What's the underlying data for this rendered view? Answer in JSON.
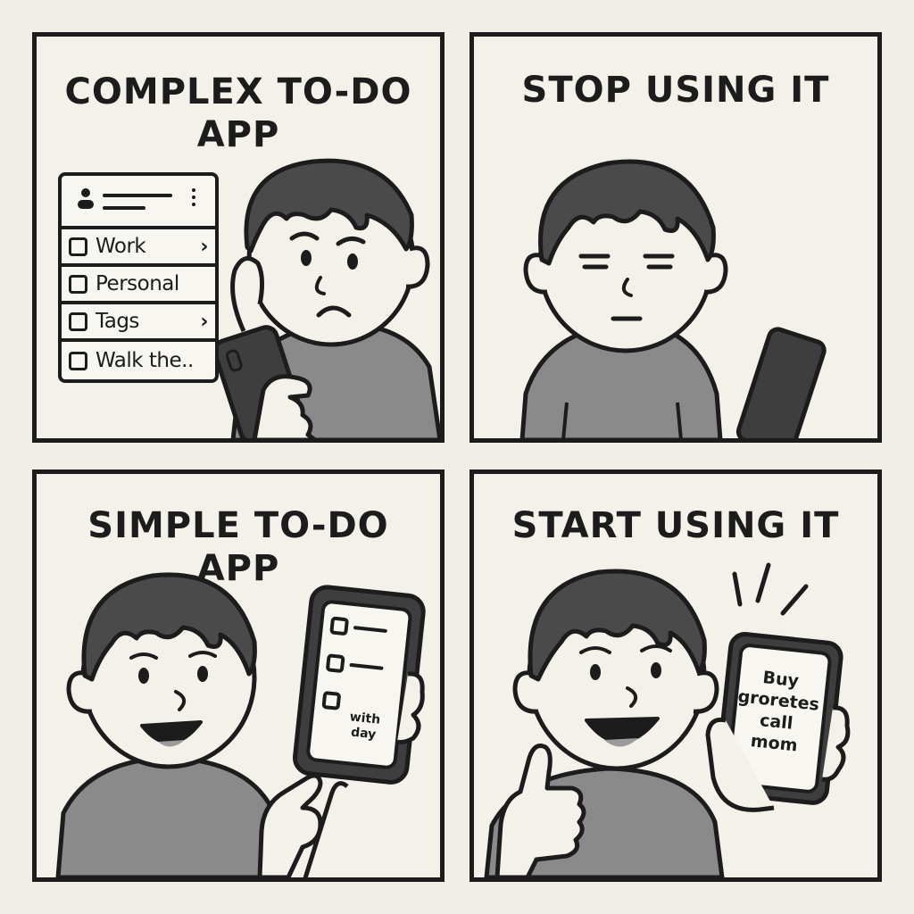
{
  "panels": {
    "complex": {
      "caption_line1": "COMPLEX TO-DO",
      "caption_line2": "APP",
      "menu_items": [
        {
          "label": "Work",
          "chevron": "›"
        },
        {
          "label": "Personal",
          "chevron": ""
        },
        {
          "label": "Tags",
          "chevron": "›"
        },
        {
          "label": "Walk the..",
          "chevron": ""
        }
      ]
    },
    "stop": {
      "caption": "STOP USING IT"
    },
    "simple": {
      "caption_line1": "SIMPLE TO-DO",
      "caption_line2": "APP",
      "phone_note": "with day"
    },
    "start": {
      "caption": "START USING IT",
      "phone_lines": [
        "Buy",
        "groretes",
        "call",
        "mom"
      ]
    }
  },
  "colors": {
    "ink": "#1c1c1c",
    "paper": "#f4f1ea",
    "shirt": "#8a8a8a",
    "hair": "#4a4a4a",
    "phone": "#3e3e3e"
  }
}
